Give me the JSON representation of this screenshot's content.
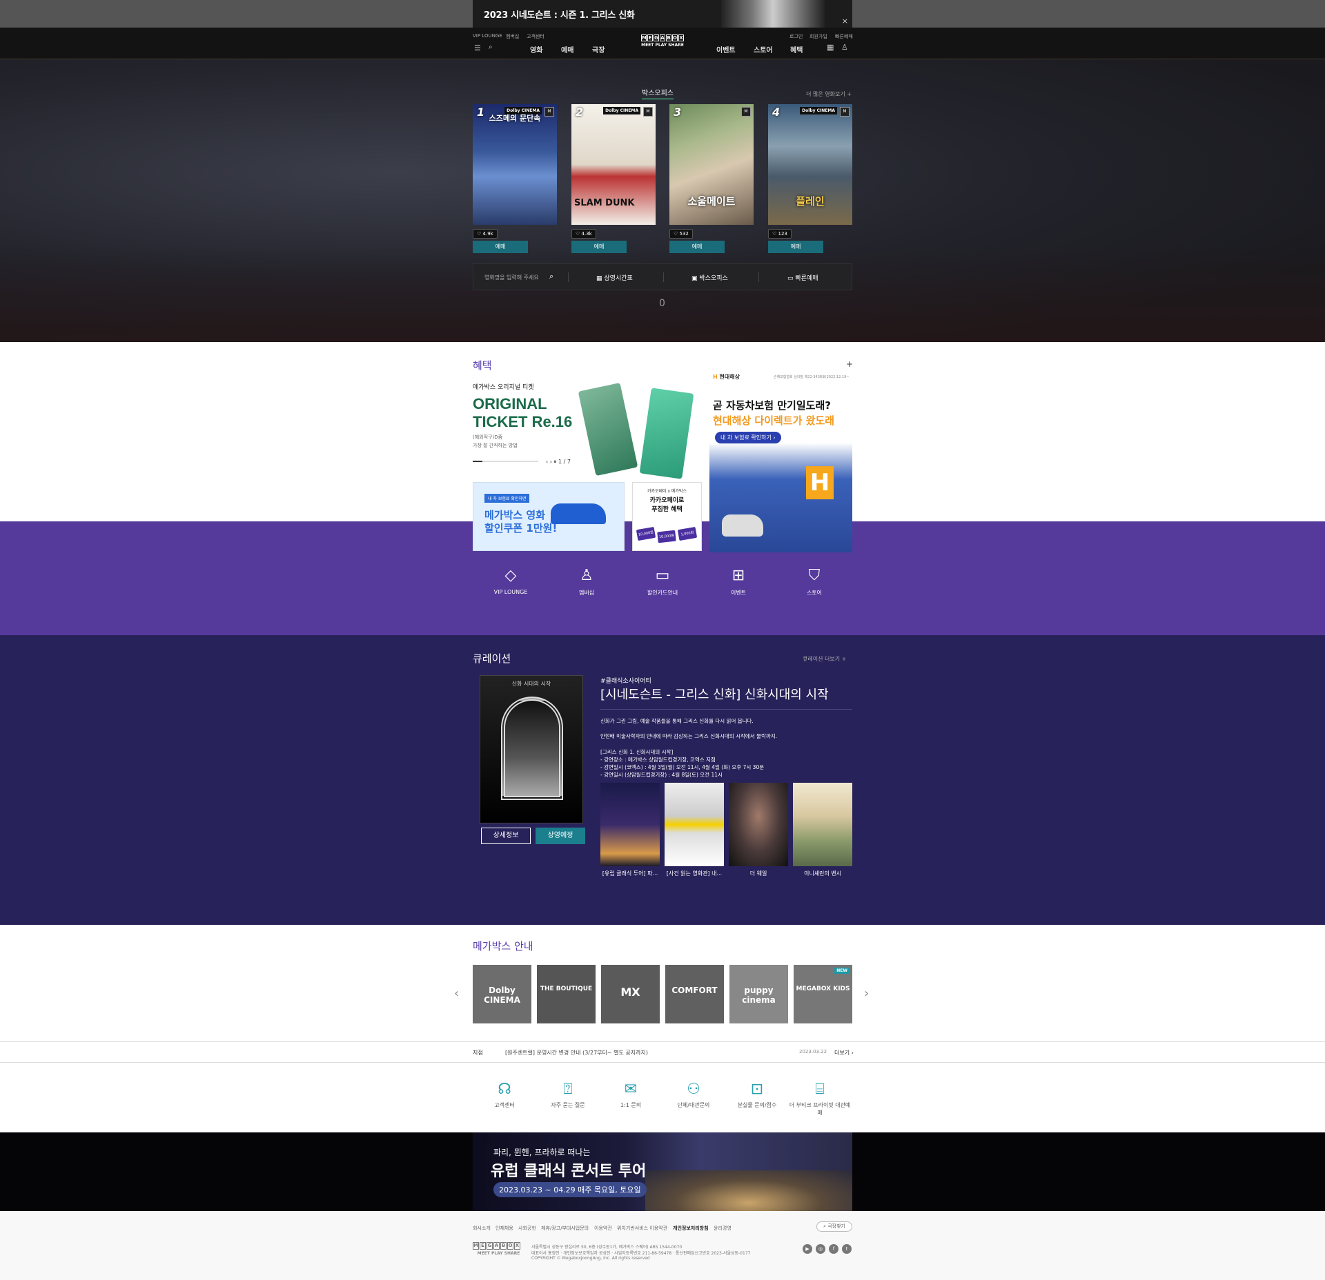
{
  "top_banner": {
    "title": "2023 시네도슨트 : 시즌 1. 그리스 신화",
    "close": "×"
  },
  "header": {
    "util_left": [
      "VIP LOUNGE",
      "멤버십",
      "고객센터"
    ],
    "util_right": [
      "로그인",
      "회원가입",
      "빠른예매"
    ],
    "nav_left": [
      "영화",
      "예매",
      "극장"
    ],
    "nav_right": [
      "이벤트",
      "스토어",
      "혜택"
    ],
    "logo_letters": [
      "M",
      "E",
      "G",
      "A",
      "B",
      "O",
      "X"
    ],
    "logo_tag": "MEET PLAY SHARE"
  },
  "boxoffice": {
    "title": "박스오피스",
    "more": "더 많은 영화보기 +",
    "movies": [
      {
        "rank": "1",
        "title": "스즈메의 문단속",
        "likes": "4.9k",
        "book": "예매",
        "dolby": "Dolby CINEMA"
      },
      {
        "rank": "2",
        "title": "SLAM DUNK",
        "likes": "4.3k",
        "book": "예매",
        "dolby": "Dolby CINEMA"
      },
      {
        "rank": "3",
        "title": "소울메이트",
        "likes": "532",
        "book": "예매"
      },
      {
        "rank": "4",
        "title": "플레인",
        "likes": "123",
        "book": "예매",
        "dolby": "Dolby CINEMA"
      }
    ],
    "search_placeholder": "영화명을 입력해 주세요",
    "quick": [
      "상영시간표",
      "박스오피스",
      "빠른예매"
    ],
    "indicator": "0"
  },
  "benefits": {
    "title": "혜택",
    "plus": "+",
    "ticket": {
      "small": "메가박스 오리지널 티켓",
      "big1": "ORIGINAL",
      "big2": "TICKET Re.16",
      "desc1": "(해외직구)D줌",
      "desc2": "가장 잘 간직하는 방법",
      "pager": "‹ › ⏸ 1 / 7"
    },
    "hyundai": {
      "brand_icon": "H",
      "brand": "현대해상",
      "fine": "손해보험협회 심의필 제22-3438호(2022.12.19~2023.12.18)",
      "line1": "곧 자동차보험 만기일도래?",
      "line2": "현대해상 다이렉트가 왔도래",
      "cta": "내 차 보험료 확인하기 ›",
      "logo": "H"
    },
    "coupon": {
      "pill": "내 차 보험료 확인하면",
      "line1": "메가박스 영화",
      "line2": "할인쿠폰 1만원!"
    },
    "kakao": {
      "small": "카카오페이 x 메가박스",
      "line1": "카카오페이로",
      "line2": "푸짐한 혜택",
      "chips": [
        "10,000원",
        "10,000원",
        "1,000원"
      ]
    },
    "quick_icons": [
      {
        "icon": "gem-icon",
        "label": "VIP LOUNGE"
      },
      {
        "icon": "person-icon",
        "label": "멤버십"
      },
      {
        "icon": "card-icon",
        "label": "할인카드안내"
      },
      {
        "icon": "gift-icon",
        "label": "이벤트"
      },
      {
        "icon": "popcorn-icon",
        "label": "스토어"
      }
    ]
  },
  "curation": {
    "title": "큐레이션",
    "more": "큐레이션 더보기 +",
    "poster_title": "신화 시대의 시작",
    "detail_btn": "상세정보",
    "schedule_btn": "상영예정",
    "tag": "#클래식소사이어티",
    "headline": "[시네도슨트 - 그리스 신화] 신화시대의 시작",
    "p1": "신화가 그린 그림, 예술 작품들을 통해 그리스 신화를 다시 읽어 봅니다.",
    "p2": "안현배 미술사학자의 안내에 따라 감상하는 그리스 신화시대의 시작에서 물락까지.",
    "p3": "[그리스 신화 1. 신화시대의 시작]",
    "p4": "- 강연장소 : 메가박스 상암월드컵경기장, 코엑스 지점",
    "p5": "- 강연일시 (코엑스) : 4월 3일(월) 오전 11시, 4월 4일 (화) 오후 7시 30분",
    "p6": "- 강연일시 (상암월드컵경기장) : 4월 8일(토) 오전 11시",
    "thumbs": [
      "[유럽 클래식 투어] 파...",
      "[사건 읽는 영화관] 내...",
      "더 웨일",
      "이니셰린의 밴시"
    ]
  },
  "guide": {
    "title": "메가박스 안내",
    "items": [
      "Dolby CINEMA",
      "THE BOUTIQUE",
      "MX",
      "COMFORT",
      "puppy cinema",
      "MEGABOX KIDS"
    ],
    "new_badge": "NEW",
    "prev": "‹",
    "next": "›"
  },
  "notice": {
    "label": "지점",
    "branch": "[원주센트럴]",
    "text": "[원주센트럴] 운영시간 변경 안내 (3/27부터~ 별도 공지까지)",
    "date": "2023.03.22",
    "more": "더보기 ›"
  },
  "support": [
    {
      "icon": "headset-icon",
      "label": "고객센터"
    },
    {
      "icon": "faq-icon",
      "label": "자주 묻는 질문"
    },
    {
      "icon": "inquiry-icon",
      "label": "1:1 문의"
    },
    {
      "icon": "group-icon",
      "label": "단체/대관문의"
    },
    {
      "icon": "lost-icon",
      "label": "분실물 문의/접수"
    },
    {
      "icon": "private-icon",
      "label": "더 부티크 프라이빗 대관예매"
    }
  ],
  "concert": {
    "line1": "파리, 뮌헨, 프라하로 떠나는",
    "line2": "유럽 클래식 콘서트 투어",
    "date": "2023.03.23 ~ 04.29  매주 목요일, 토요일"
  },
  "footer": {
    "links": [
      "회사소개",
      "인재채용",
      "사회공헌",
      "제휴/광고/부대사업문의",
      "이용약관",
      "위치기반서비스 이용약관",
      "개인정보처리방침",
      "윤리경영"
    ],
    "search": "극장찾기",
    "addr1": "서울특별시 성동구 왕십리로 50, 6층 (성수동1가, 메가박스 스퀘어) ARS 1544-0070",
    "addr2": "대표이사 홍정인 · 개인정보보호책임자 공성진 · 사업자등록번호 211-86-59478 · 통신판매업신고번호 2023-서울성동-0177",
    "copyright": "COPYRIGHT © MegaboxJoongAng, Inc. All rights reserved",
    "sns": [
      "▶",
      "◎",
      "f",
      "t"
    ]
  }
}
